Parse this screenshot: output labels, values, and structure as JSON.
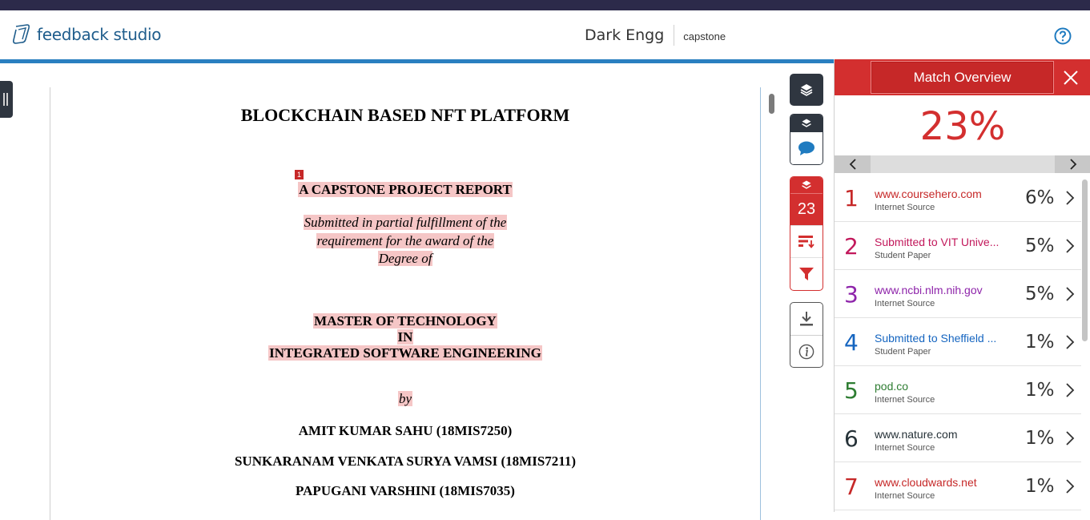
{
  "header": {
    "logo_text": "feedback studio",
    "doc_title": "Dark Engg",
    "doc_subtitle": "capstone"
  },
  "document": {
    "title": "BLOCKCHAIN BASED NFT PLATFORM",
    "match_marker": "1",
    "report_heading": "A CAPSTONE PROJECT REPORT",
    "submitted_lines": [
      "Submitted in partial fulfillment of the",
      "requirement for the award of the",
      "Degree of"
    ],
    "degree_lines": [
      "MASTER OF TECHNOLOGY",
      "IN",
      "INTEGRATED SOFTWARE ENGINEERING"
    ],
    "by": "by",
    "authors": [
      "AMIT KUMAR SAHU (18MIS7250)",
      "SUNKARANAM VENKATA SURYA VAMSI (18MIS7211)",
      "PAPUGANI VARSHINI (18MIS7035)"
    ]
  },
  "toolbar": {
    "similarity_count": "23"
  },
  "panel": {
    "title": "Match Overview",
    "overall_percent": "23%",
    "matches": [
      {
        "rank": "1",
        "source": "www.coursehero.com",
        "type": "Internet Source",
        "percent": "6%",
        "color": "#c62828"
      },
      {
        "rank": "2",
        "source": "Submitted to VIT Unive...",
        "type": "Student Paper",
        "percent": "5%",
        "color": "#c2185b"
      },
      {
        "rank": "3",
        "source": "www.ncbi.nlm.nih.gov",
        "type": "Internet Source",
        "percent": "5%",
        "color": "#8e24aa"
      },
      {
        "rank": "4",
        "source": "Submitted to Sheffield ...",
        "type": "Student Paper",
        "percent": "1%",
        "color": "#1565c0"
      },
      {
        "rank": "5",
        "source": "pod.co",
        "type": "Internet Source",
        "percent": "1%",
        "color": "#2e7d32"
      },
      {
        "rank": "6",
        "source": "www.nature.com",
        "type": "Internet Source",
        "percent": "1%",
        "color": "#263238"
      },
      {
        "rank": "7",
        "source": "www.cloudwards.net",
        "type": "Internet Source",
        "percent": "1%",
        "color": "#c62828"
      }
    ]
  },
  "colors": {
    "brand_blue": "#2a7fc0",
    "match_red": "#d32f2f",
    "highlight_pink": "#f5c6c6",
    "dark_rail": "#2f3640"
  },
  "icons": {
    "help": "help-circle-icon",
    "layers": "layers-icon",
    "comment": "comment-bubble-icon",
    "sort": "sort-icon",
    "filter": "filter-icon",
    "download": "download-icon",
    "info": "info-icon",
    "close": "close-icon"
  }
}
